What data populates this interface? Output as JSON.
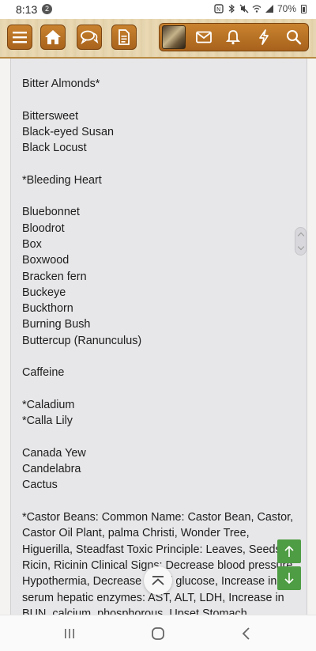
{
  "status_bar": {
    "time": "8:13",
    "notification_count": "2",
    "battery": "70%"
  },
  "toolbar": {
    "buttons": [
      "menu-icon",
      "home-icon",
      "chat-icon",
      "document-icon",
      "avatar",
      "mail-icon",
      "bell-icon",
      "lightning-icon",
      "search-icon"
    ],
    "accent_color": "#b26a22",
    "banner_color": "#e6d5ae"
  },
  "plant_list": {
    "items": [
      "Bitter Almonds*",
      "",
      "Bittersweet",
      "Black-eyed Susan",
      "Black Locust",
      "",
      "*Bleeding Heart",
      "",
      "Bluebonnet",
      "Bloodrot",
      "Box",
      "Boxwood",
      "Bracken fern",
      "Buckeye",
      "Buckthorn",
      "Burning Bush",
      "Buttercup (Ranunculus)",
      "",
      "Caffeine",
      "",
      "*Caladium",
      "*Calla Lily",
      "",
      "Canada Yew",
      "Candelabra",
      "Cactus",
      ""
    ],
    "castor_paragraph": "*Castor Beans: Common Name: Castor Bean, Castor, Castor Oil Plant, palma Christi, Wonder Tree, Higuerilla, Steadfast Toxic Principle: Leaves, Seeds, Ricin, Ricinin Clinical Signs: Decrease blood pressure, Hypothermia, Decrease blood glucose, Increase in serum hepatic enzymes: AST, ALT, LDH, Increase in BUN, calcium, phosphorous, Upset Stomach"
  },
  "controls": {
    "scroll_up_icon": "arrow-up-icon",
    "scroll_down_icon": "arrow-down-icon",
    "back_to_top_icon": "chevron-up-icon",
    "jump_button_color": "#4e9c43"
  }
}
